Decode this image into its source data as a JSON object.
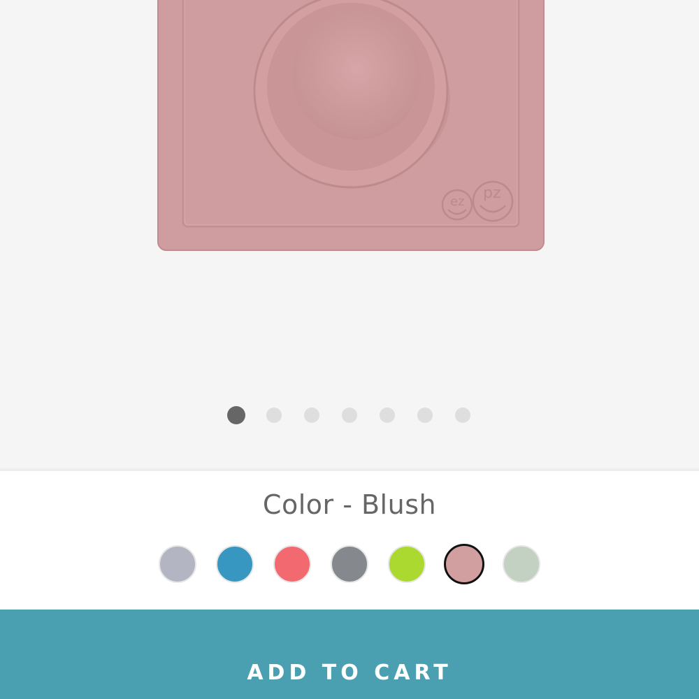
{
  "product": {
    "image_icon": "ezpz-mini-bowl-product-image",
    "image_color": "#cf9d9f",
    "brand_mark": "ez pz"
  },
  "gallery": {
    "image_count": 7,
    "active_index": 0
  },
  "color_selector": {
    "label": "Color - Blush",
    "selected_index": 5,
    "swatches": [
      {
        "color": "#b3b6c2"
      },
      {
        "color": "#3897c0"
      },
      {
        "color": "#f26a70"
      },
      {
        "color": "#85898d"
      },
      {
        "color": "#acd92f"
      },
      {
        "color": "#d29fa1"
      },
      {
        "color": "#c3d1c2"
      }
    ]
  },
  "cart": {
    "button_label": "ADD TO CART",
    "background": "#4aa0b1"
  },
  "colors": {
    "gallery_bg": "#f5f5f5",
    "dot_active": "#666666",
    "dot_inactive": "#dedede",
    "label_text": "#666666"
  }
}
